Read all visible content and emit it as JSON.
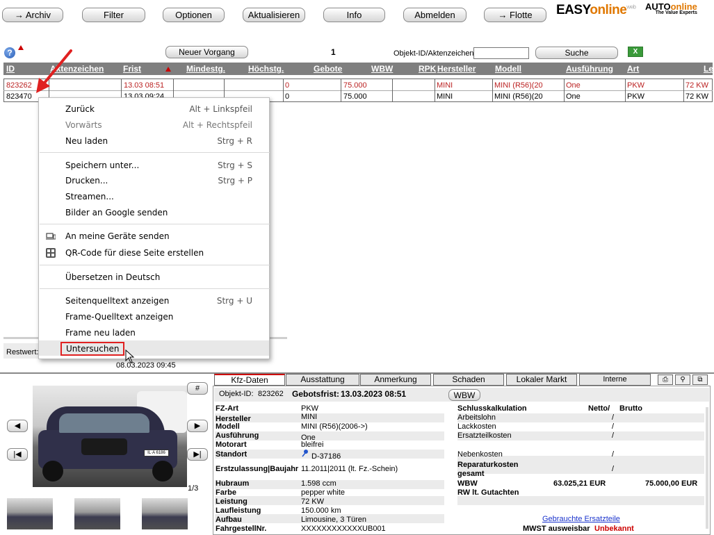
{
  "toolbar": {
    "archiv": "→ Archiv",
    "filter": "Filter",
    "optionen": "Optionen",
    "aktualisieren": "Aktualisieren",
    "info": "Info",
    "abmelden": "Abmelden",
    "flotte": "→ Flotte"
  },
  "brand": {
    "easy": "EASY",
    "online": "online",
    "web": "web",
    "auto": "AUTO",
    "auto_online": "online",
    "tagline": "The Value Experts"
  },
  "search": {
    "neuer_vorgang": "Neuer Vorgang",
    "page": "1",
    "objekt_label": "Objekt-ID/Aktenzeichen",
    "objekt_value": "",
    "suche": "Suche"
  },
  "table": {
    "headers": [
      "ID",
      "Aktenzeichen",
      "Frist",
      "Mindestg.",
      "Höchstg.",
      "Gebote",
      "WBW",
      "RPK",
      "Hersteller",
      "Modell",
      "Ausführung",
      "Art",
      "Le"
    ],
    "rows": [
      {
        "id": "823262",
        "aktenzeichen": "",
        "frist": "13.03 08:51",
        "gebote": "0",
        "wbw": "75.000",
        "hersteller": "MINI",
        "modell": "MINI (R56)(20",
        "ausfuehrung": "One",
        "art": "PKW",
        "le": "72 KW"
      },
      {
        "id": "823470",
        "aktenzeichen": "",
        "frist": "13.03 09:24",
        "gebote": "0",
        "wbw": "75.000",
        "hersteller": "MINI",
        "modell": "MINI (R56)(20",
        "ausfuehrung": "One",
        "art": "PKW",
        "le": "72 KW"
      }
    ]
  },
  "context_menu": {
    "items": [
      {
        "label": "Zurück",
        "shortcut": "Alt + Linkspfeil"
      },
      {
        "label": "Vorwärts",
        "shortcut": "Alt + Rechtspfeil"
      },
      {
        "label": "Neu laden",
        "shortcut": "Strg + R"
      },
      {
        "label": "Speichern unter...",
        "shortcut": "Strg + S"
      },
      {
        "label": "Drucken...",
        "shortcut": "Strg + P"
      },
      {
        "label": "Streamen...",
        "shortcut": ""
      },
      {
        "label": "Bilder an Google senden",
        "shortcut": ""
      },
      {
        "label": "An meine Geräte senden",
        "shortcut": ""
      },
      {
        "label": "QR-Code für diese Seite erstellen",
        "shortcut": ""
      },
      {
        "label": "Übersetzen in Deutsch",
        "shortcut": ""
      },
      {
        "label": "Seitenquelltext anzeigen",
        "shortcut": "Strg + U"
      },
      {
        "label": "Frame-Quelltext anzeigen",
        "shortcut": ""
      },
      {
        "label": "Frame neu laden",
        "shortcut": ""
      },
      {
        "label": "Untersuchen",
        "shortcut": ""
      }
    ]
  },
  "restwert": {
    "label": "Restwert:",
    "date": "08.03.2023 09:45"
  },
  "gallery": {
    "hash": "#",
    "counter": "1/3",
    "plate": "IL·A 6186"
  },
  "tabs": [
    "Kfz-Daten",
    "Ausstattung",
    "Anmerkung",
    "Schaden",
    "Lokaler Markt",
    "Interne Bemerkungen"
  ],
  "details": {
    "objekt_label": "Objekt-ID:",
    "objekt_id": "823262",
    "frist_label": "Gebotsfrist:",
    "frist": "13.03.2023 08:51",
    "wbw_btn": "WBW",
    "left": [
      {
        "label": "FZ-Art",
        "value": "PKW"
      },
      {
        "label": "Hersteller",
        "value": "MINI"
      },
      {
        "label": "Modell",
        "value": "MINI (R56)(2006->)"
      },
      {
        "label": "Ausführung",
        "value": "One"
      },
      {
        "label": "Motorart",
        "value": "bleifrei"
      },
      {
        "label": "Standort",
        "value": "D-37186"
      },
      {
        "label": "Erstzulassung|Baujahr",
        "value": "11.2011|2011 (lt. Fz.-Schein)"
      },
      {
        "label": "Hubraum",
        "value": "1.598 ccm"
      },
      {
        "label": "Farbe",
        "value": "pepper white"
      },
      {
        "label": "Leistung",
        "value": "72 KW"
      },
      {
        "label": "Laufleistung",
        "value": "150.000 km"
      },
      {
        "label": "Aufbau",
        "value": "Limousine, 3 Türen"
      },
      {
        "label": "FahrgestellNr.",
        "value": "XXXXXXXXXXXXUB001"
      }
    ],
    "calc_title": "Schlusskalkulation",
    "netto": "Netto/",
    "brutto": "Brutto",
    "calc_rows": [
      "Arbeitslohn",
      "Lackkosten",
      "Ersatzteilkosten",
      "Nebenkosten"
    ],
    "slash": "/",
    "rep1": "Reparaturkosten",
    "rep2": "gesamt",
    "wbw_label": "WBW",
    "wbw_netto": "63.025,21 EUR",
    "wbw_brutto": "75.000,00 EUR",
    "rw_label": "RW lt. Gutachten",
    "link": "Gebrauchte Ersatzteile",
    "mwst_label": "MWST ausweisbar",
    "mwst_value": "Unbekannt"
  }
}
